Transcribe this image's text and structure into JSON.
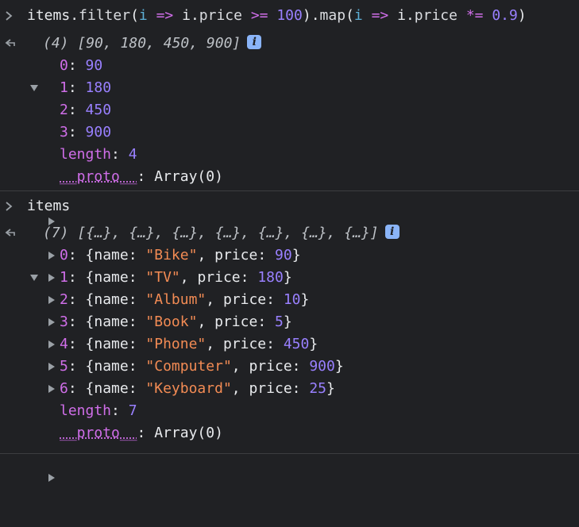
{
  "console": {
    "entry1": {
      "input": {
        "tokens": [
          {
            "t": "items",
            "c": "plain"
          },
          {
            "t": ".",
            "c": "plain"
          },
          {
            "t": "filter",
            "c": "func"
          },
          {
            "t": "(",
            "c": "plain"
          },
          {
            "t": "i",
            "c": "param"
          },
          {
            "t": " => ",
            "c": "op"
          },
          {
            "t": "i",
            "c": "plain"
          },
          {
            "t": ".",
            "c": "plain"
          },
          {
            "t": "price",
            "c": "func"
          },
          {
            "t": " >= ",
            "c": "op"
          },
          {
            "t": "100",
            "c": "num"
          },
          {
            "t": ").",
            "c": "plain"
          },
          {
            "t": "map",
            "c": "func"
          },
          {
            "t": "(",
            "c": "plain"
          },
          {
            "t": "i",
            "c": "param"
          },
          {
            "t": " => ",
            "c": "op"
          },
          {
            "t": "i",
            "c": "plain"
          },
          {
            "t": ".",
            "c": "plain"
          },
          {
            "t": "price",
            "c": "func"
          },
          {
            "t": " *= ",
            "c": "op"
          },
          {
            "t": "0.9",
            "c": "num"
          },
          {
            "t": ")",
            "c": "plain"
          }
        ]
      },
      "result": {
        "header_count": "(4)",
        "header_preview": "[90, 180, 450, 900]",
        "info_label": "i",
        "items": [
          {
            "index": "0",
            "value": "90"
          },
          {
            "index": "1",
            "value": "180"
          },
          {
            "index": "2",
            "value": "450"
          },
          {
            "index": "3",
            "value": "900"
          }
        ],
        "length_label": "length",
        "length_value": "4",
        "proto_label": "__proto__",
        "proto_value": "Array(0)"
      }
    },
    "entry2": {
      "input": {
        "text": "items"
      },
      "result": {
        "header_count": "(7)",
        "header_preview": "[{…}, {…}, {…}, {…}, {…}, {…}, {…}]",
        "info_label": "i",
        "items": [
          {
            "index": "0",
            "name": "\"Bike\"",
            "price": "90"
          },
          {
            "index": "1",
            "name": "\"TV\"",
            "price": "180"
          },
          {
            "index": "2",
            "name": "\"Album\"",
            "price": "10"
          },
          {
            "index": "3",
            "name": "\"Book\"",
            "price": "5"
          },
          {
            "index": "4",
            "name": "\"Phone\"",
            "price": "450"
          },
          {
            "index": "5",
            "name": "\"Computer\"",
            "price": "900"
          },
          {
            "index": "6",
            "name": "\"Keyboard\"",
            "price": "25"
          }
        ],
        "name_key": "name",
        "price_key": "price",
        "length_label": "length",
        "length_value": "7",
        "proto_label": "__proto__",
        "proto_value": "Array(0)"
      }
    }
  },
  "colors": {
    "background": "#202124",
    "number": "#9980ff",
    "string": "#f28b54",
    "index": "#d06ee9",
    "info_badge": "#8ab4f8"
  },
  "icons": {
    "input_prompt": "chevron-right-icon",
    "result_prompt": "return-arrow-icon",
    "expanded": "triangle-down-icon",
    "collapsed": "triangle-right-icon",
    "info": "info-icon"
  }
}
